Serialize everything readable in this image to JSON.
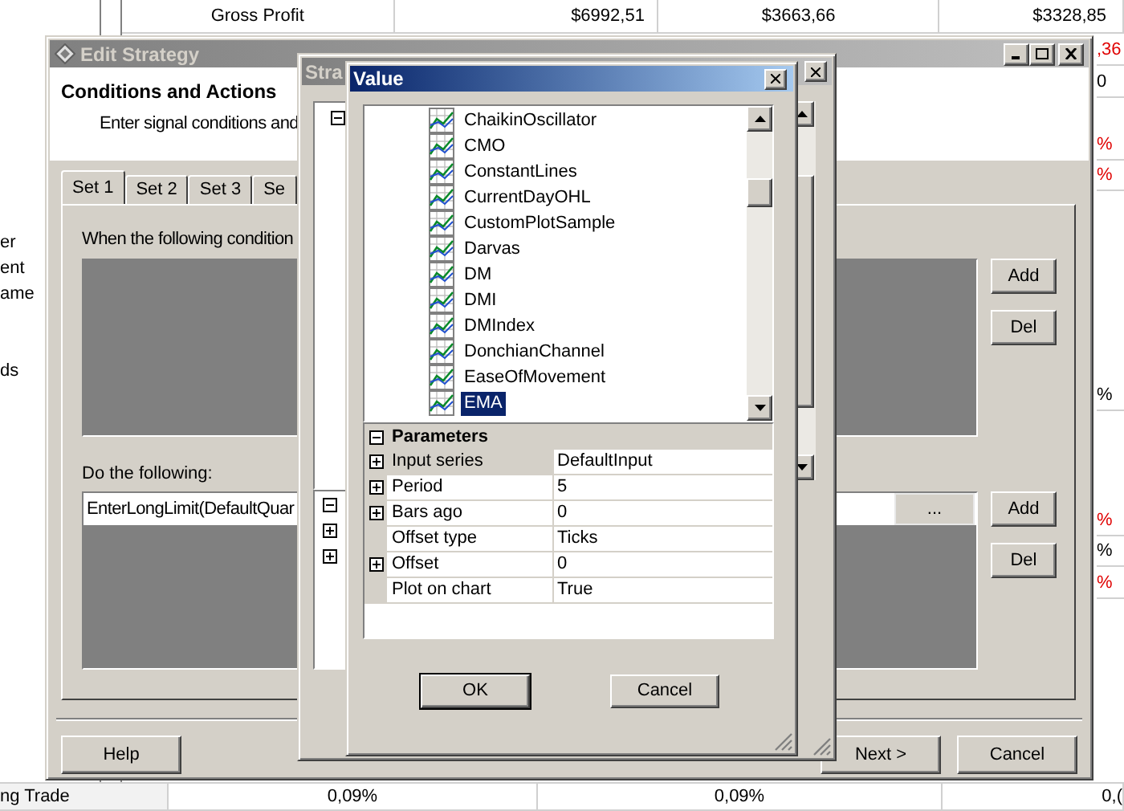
{
  "background_table": {
    "top_row": [
      "Gross Profit",
      "$6992,51",
      "$3663,66",
      "$3328,85"
    ],
    "left_fragments": [
      "er",
      "ent",
      "ame",
      "ds"
    ],
    "right_fragments": [
      {
        "text": ",36",
        "negative": true
      },
      {
        "text": "0",
        "negative": false
      },
      {
        "text": "%",
        "negative": true
      },
      {
        "text": "%",
        "negative": true
      },
      {
        "text": "%",
        "negative": false
      },
      {
        "text": "%",
        "negative": true
      },
      {
        "text": "%",
        "negative": false
      },
      {
        "text": "%",
        "negative": true
      }
    ],
    "bottom_row": [
      "ng Trade",
      "0,09%",
      "0,09%",
      "0,("
    ]
  },
  "edit_strategy": {
    "title": "Edit Strategy",
    "header_title": "Conditions and Actions",
    "header_text": "Enter signal conditions and",
    "tabs": [
      {
        "label": "Set 1",
        "selected": true
      },
      {
        "label": "Set 2",
        "selected": false
      },
      {
        "label": "Set 3",
        "selected": false
      },
      {
        "label": "Se",
        "selected": false
      }
    ],
    "conditions_label": "When the following condition",
    "condition_buttons": [
      "Add",
      "Del"
    ],
    "actions_label": "Do the following:",
    "actions": [
      {
        "text": "EnterLongLimit(DefaultQuar",
        "button": "..."
      }
    ],
    "action_buttons": [
      "Add",
      "Del"
    ],
    "footer_buttons": [
      "Help",
      "Next >",
      "Cancel"
    ]
  },
  "strategy_window": {
    "title": "Stra",
    "tree_nodes": [
      {
        "expanded": true
      }
    ],
    "lower_nodes": [
      {
        "expanded": true
      },
      {
        "expanded": false
      },
      {
        "expanded": false
      }
    ]
  },
  "value_dialog": {
    "title": "Value",
    "items": [
      {
        "label": "ChaikinOscillator",
        "selected": false
      },
      {
        "label": "CMO",
        "selected": false
      },
      {
        "label": "ConstantLines",
        "selected": false
      },
      {
        "label": "CurrentDayOHL",
        "selected": false
      },
      {
        "label": "CustomPlotSample",
        "selected": false
      },
      {
        "label": "Darvas",
        "selected": false
      },
      {
        "label": "DM",
        "selected": false
      },
      {
        "label": "DMI",
        "selected": false
      },
      {
        "label": "DMIndex",
        "selected": false
      },
      {
        "label": "DonchianChannel",
        "selected": false
      },
      {
        "label": "EaseOfMovement",
        "selected": false
      },
      {
        "label": "EMA",
        "selected": true
      }
    ],
    "parameters": {
      "title": "Parameters",
      "expanded": true,
      "rows": [
        {
          "name": "Input series",
          "value": "DefaultInput",
          "expandable": true,
          "selected": true
        },
        {
          "name": "Period",
          "value": "5",
          "expandable": true,
          "selected": false
        },
        {
          "name": "Bars ago",
          "value": "0",
          "expandable": true,
          "selected": false
        },
        {
          "name": "Offset type",
          "value": "Ticks",
          "expandable": false,
          "selected": false
        },
        {
          "name": "Offset",
          "value": "0",
          "expandable": true,
          "selected": false
        },
        {
          "name": "Plot on chart",
          "value": "True",
          "expandable": false,
          "selected": false
        }
      ]
    },
    "buttons": [
      "OK",
      "Cancel"
    ]
  }
}
